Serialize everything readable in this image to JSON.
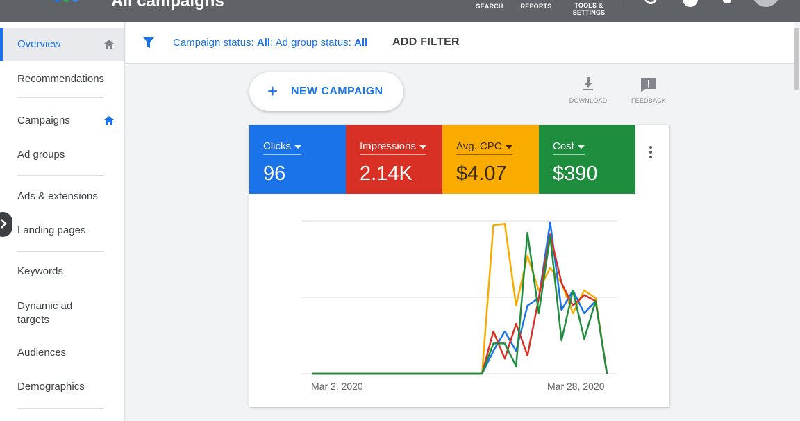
{
  "header": {
    "page_title": "All campaigns",
    "items": [
      {
        "name": "search",
        "label": "SEARCH"
      },
      {
        "name": "reports",
        "label": "REPORTS"
      },
      {
        "name": "tools",
        "label": "TOOLS & SETTINGS"
      }
    ],
    "logo_colors": [
      "#1a73e8",
      "#34a853",
      "#4285f4"
    ]
  },
  "sidebar": {
    "items": [
      {
        "label": "Overview",
        "active": true,
        "home_icon": true
      },
      {
        "label": "Recommendations"
      },
      {
        "label": "Campaigns",
        "home_icon": true
      },
      {
        "label": "Ad groups"
      },
      {
        "label": "Ads & extensions"
      },
      {
        "label": "Landing pages"
      },
      {
        "label": "Keywords"
      },
      {
        "label": "Dynamic ad targets"
      },
      {
        "label": "Audiences"
      },
      {
        "label": "Demographics"
      }
    ]
  },
  "filter": {
    "campaign_status_label": "Campaign status:",
    "campaign_status_value": "All",
    "separator": ";",
    "adgroup_status_label": "Ad group status:",
    "adgroup_status_value": "All",
    "add_filter_label": "ADD FILTER"
  },
  "actions": {
    "new_campaign_label": "NEW CAMPAIGN",
    "download_label": "DOWNLOAD",
    "feedback_label": "FEEDBACK"
  },
  "scorecards": [
    {
      "name": "Clicks",
      "value": "96",
      "color": "#1a73e8"
    },
    {
      "name": "Impressions",
      "value": "2.14K",
      "color": "#d93025"
    },
    {
      "name": "Avg. CPC",
      "value": "$4.07",
      "color": "#f9ab00"
    },
    {
      "name": "Cost",
      "value": "$390",
      "color": "#1e8e3e"
    }
  ],
  "chart_data": {
    "type": "line",
    "x_start_label": "Mar 2, 2020",
    "x_end_label": "Mar 28, 2020",
    "y_normalized_range": [
      0,
      1
    ],
    "gridlines": 3,
    "x": [
      "Mar 2",
      "Mar 3",
      "Mar 4",
      "Mar 5",
      "Mar 6",
      "Mar 7",
      "Mar 8",
      "Mar 9",
      "Mar 10",
      "Mar 11",
      "Mar 12",
      "Mar 13",
      "Mar 14",
      "Mar 15",
      "Mar 16",
      "Mar 17",
      "Mar 18",
      "Mar 19",
      "Mar 20",
      "Mar 21",
      "Mar 22",
      "Mar 23",
      "Mar 24",
      "Mar 25",
      "Mar 26",
      "Mar 27",
      "Mar 28"
    ],
    "series": [
      {
        "name": "Avg. CPC",
        "color": "#f9ab00",
        "values": [
          0,
          0,
          0,
          0,
          0,
          0,
          0,
          0,
          0,
          0,
          0,
          0,
          0,
          0,
          0,
          0,
          0.98,
          0.99,
          0.45,
          0.78,
          0.55,
          0.7,
          0.6,
          0.4,
          0.55,
          0.5,
          0
        ]
      },
      {
        "name": "Clicks",
        "color": "#1a73e8",
        "values": [
          0,
          0,
          0,
          0,
          0,
          0,
          0,
          0,
          0,
          0,
          0,
          0,
          0,
          0,
          0,
          0,
          0.15,
          0.28,
          0.15,
          0.45,
          0.5,
          1.0,
          0.42,
          0.55,
          0.4,
          0.48,
          0
        ]
      },
      {
        "name": "Impressions",
        "color": "#d93025",
        "values": [
          0,
          0,
          0,
          0,
          0,
          0,
          0,
          0,
          0,
          0,
          0,
          0,
          0,
          0,
          0,
          0,
          0.28,
          0.1,
          0.33,
          0.12,
          0.5,
          0.92,
          0.6,
          0.45,
          0.52,
          0.48,
          0
        ]
      },
      {
        "name": "Cost",
        "color": "#1e8e3e",
        "values": [
          0,
          0,
          0,
          0,
          0,
          0,
          0,
          0,
          0,
          0,
          0,
          0,
          0,
          0,
          0,
          0,
          0.2,
          0.2,
          0.05,
          0.93,
          0.4,
          0.91,
          0.22,
          0.55,
          0.23,
          0.48,
          0
        ]
      }
    ]
  }
}
